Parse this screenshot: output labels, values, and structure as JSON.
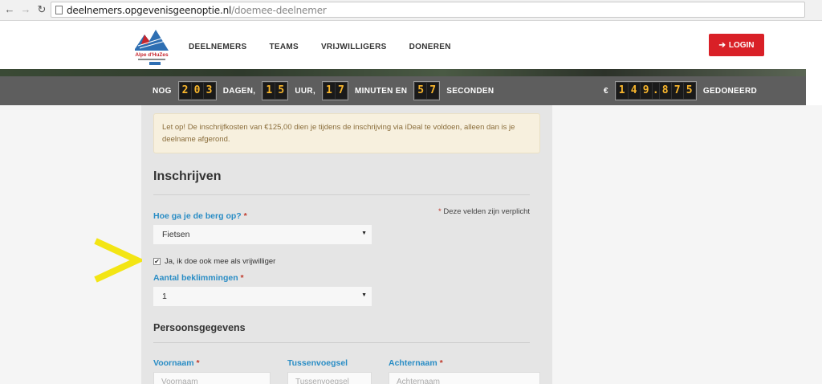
{
  "browser": {
    "url_host": "deelnemers.opgevenisgeenoptie.nl",
    "url_path": "/doemee-deelnemer"
  },
  "header": {
    "logo_text": "Alpe d'HuZes",
    "nav": [
      "DEELNEMERS",
      "TEAMS",
      "VRIJWILLIGERS",
      "DONEREN"
    ],
    "login_label": "LOGIN"
  },
  "countdown": {
    "nog": "NOG",
    "days_digits": [
      "2",
      "0",
      "3"
    ],
    "days_label": "DAGEN,",
    "hours_digits": [
      "1",
      "5"
    ],
    "hours_label": "UUR,",
    "minutes_digits": [
      "1",
      "7"
    ],
    "minutes_label": "MINUTEN EN",
    "seconds_digits": [
      "5",
      "7"
    ],
    "seconds_label": "SECONDEN",
    "currency": "€",
    "donated_digits": [
      "1",
      "4",
      "9",
      ".",
      "8",
      "7",
      "5"
    ],
    "donated_label": "GEDONEERD"
  },
  "form": {
    "notice": "Let op! De inschrijfkosten van €125,00 dien je tijdens de inschrijving via iDeal te voldoen, alleen dan is je deelname afgerond.",
    "title": "Inschrijven",
    "required_note": "Deze velden zijn verplicht",
    "required_star": "*",
    "method_label": "Hoe ga je de berg op?",
    "method_value": "Fietsen",
    "volunteer_checkbox_label": "Ja, ik doe ook mee als vrijwilliger",
    "volunteer_checked": true,
    "climbs_label": "Aantal beklimmingen",
    "climbs_value": "1",
    "personal_title": "Persoonsgegevens",
    "first_name_label": "Voornaam",
    "first_name_placeholder": "Voornaam",
    "middle_name_label": "Tussenvoegsel",
    "middle_name_placeholder": "Tussenvoegsel",
    "last_name_label": "Achternaam",
    "last_name_placeholder": "Achternaam"
  },
  "icons": {
    "back": "arrow-left-icon",
    "forward": "arrow-right-icon",
    "reload": "reload-icon",
    "login": "sign-in-icon"
  },
  "colors": {
    "login_bg": "#d92027",
    "label_blue": "#2a8dc5",
    "digit_color": "#f7b52c",
    "annotation_yellow": "#f3e514"
  }
}
